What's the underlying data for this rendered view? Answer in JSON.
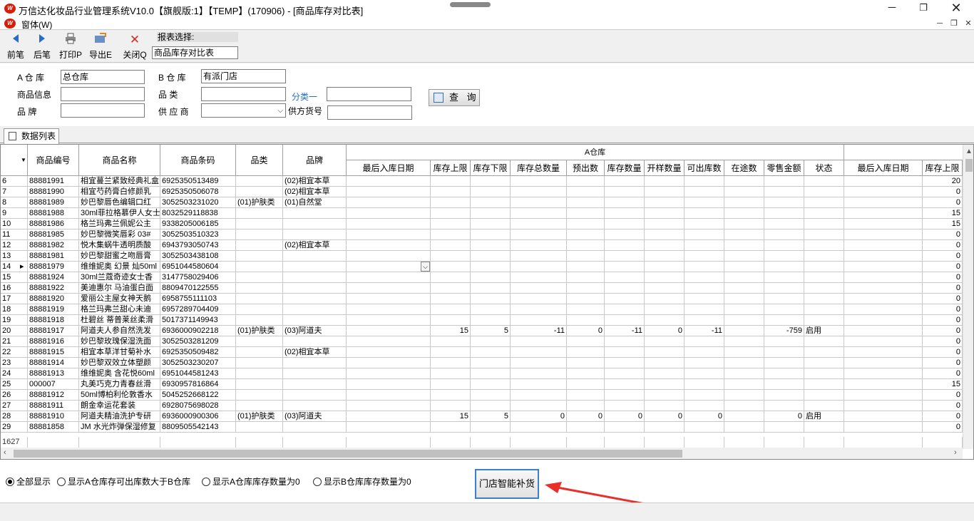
{
  "window": {
    "title": "万信达化妆品行业管理系统V10.0【旗舰版:1】【TEMP】(170906) - [商品库存对比表]",
    "menu": "窗体(W)",
    "logo_text": "W"
  },
  "toolbar": {
    "buttons": [
      {
        "label": "前笔",
        "icon": "arrow-left-icon"
      },
      {
        "label": "后笔",
        "icon": "arrow-right-icon"
      },
      {
        "label": "打印P",
        "icon": "printer-icon"
      },
      {
        "label": "导出E",
        "icon": "export-icon"
      },
      {
        "label": "关闭Q",
        "icon": "close-icon"
      }
    ],
    "report_label": "报表选择:",
    "report_value": "商品库存对比表"
  },
  "filters": {
    "a_warehouse_label": "A 仓 库",
    "a_warehouse_value": "总仓库",
    "b_warehouse_label": "B 仓 库",
    "b_warehouse_value": "有派门店",
    "product_info_label": "商品信息",
    "category_label": "品 类",
    "class1_label": "分类一",
    "brand_label": "品 牌",
    "supplier_label": "供 应 商",
    "supplier_code_label": "供方货号",
    "query_button": "查 询"
  },
  "tab": {
    "label": "数据列表"
  },
  "grid": {
    "headers": {
      "code": "商品编号",
      "name": "商品名称",
      "barcode": "商品条码",
      "category": "品类",
      "brand": "品牌",
      "a_group": "A仓库",
      "a_cols": [
        "最后入库日期",
        "库存上限",
        "库存下限",
        "库存总数量",
        "预出数",
        "库存数量",
        "开样数量",
        "可出库数",
        "在途数",
        "零售金额",
        "状态"
      ],
      "b_cols": [
        "最后入库日期",
        "库存上限"
      ]
    },
    "rows": [
      {
        "n": "6",
        "code": "88881991",
        "name": "相宜蔓兰紧致经典礼盒",
        "barcode": "6925350513489",
        "cat": "",
        "brand": "(02)相宜本草",
        "a": [
          "",
          "",
          "",
          "",
          "",
          "",
          "",
          "",
          "",
          "",
          ""
        ],
        "b": [
          "",
          "20"
        ]
      },
      {
        "n": "7",
        "code": "88881990",
        "name": "相宜芍药膏白修颜乳",
        "barcode": "6925350506078",
        "cat": "",
        "brand": "(02)相宜本草",
        "a": [
          "",
          "",
          "",
          "",
          "",
          "",
          "",
          "",
          "",
          "",
          ""
        ],
        "b": [
          "",
          "0"
        ]
      },
      {
        "n": "8",
        "code": "88881989",
        "name": "妙巴黎唇色编辑口红",
        "barcode": "3052503231020",
        "cat": "(01)护肤类",
        "brand": "(01)自然堂",
        "a": [
          "",
          "",
          "",
          "",
          "",
          "",
          "",
          "",
          "",
          "",
          ""
        ],
        "b": [
          "",
          "0"
        ]
      },
      {
        "n": "9",
        "code": "88881988",
        "name": "30ml菲拉格慕伊人女士",
        "barcode": "8032529118838",
        "cat": "",
        "brand": "",
        "a": [
          "",
          "",
          "",
          "",
          "",
          "",
          "",
          "",
          "",
          "",
          ""
        ],
        "b": [
          "",
          "15"
        ]
      },
      {
        "n": "10",
        "code": "88881986",
        "name": "格兰玛弗兰佩妮公主",
        "barcode": "9338205006185",
        "cat": "",
        "brand": "",
        "a": [
          "",
          "",
          "",
          "",
          "",
          "",
          "",
          "",
          "",
          "",
          ""
        ],
        "b": [
          "",
          "15"
        ]
      },
      {
        "n": "11",
        "code": "88881985",
        "name": "妙巴黎微笑唇彩 03#",
        "barcode": "3052503510323",
        "cat": "",
        "brand": "",
        "a": [
          "",
          "",
          "",
          "",
          "",
          "",
          "",
          "",
          "",
          "",
          ""
        ],
        "b": [
          "",
          "0"
        ]
      },
      {
        "n": "12",
        "code": "88881982",
        "name": "悦木集蜗牛透明质酸",
        "barcode": "6943793050743",
        "cat": "",
        "brand": "(02)相宜本草",
        "a": [
          "",
          "",
          "",
          "",
          "",
          "",
          "",
          "",
          "",
          "",
          ""
        ],
        "b": [
          "",
          "0"
        ]
      },
      {
        "n": "13",
        "code": "88881981",
        "name": "妙巴黎甜蜜之吻唇膏",
        "barcode": "3052503438108",
        "cat": "",
        "brand": "",
        "a": [
          "",
          "",
          "",
          "",
          "",
          "",
          "",
          "",
          "",
          "",
          ""
        ],
        "b": [
          "",
          "0"
        ]
      },
      {
        "n": "14",
        "code": "88881979",
        "name": "维维妮奥 幻景 灿50ml",
        "barcode": "6951044580604",
        "cat": "",
        "brand": "",
        "a": [
          "",
          "",
          "",
          "",
          "",
          "",
          "",
          "",
          "",
          "",
          ""
        ],
        "b": [
          "",
          "0"
        ],
        "current": true
      },
      {
        "n": "15",
        "code": "88881924",
        "name": "30ml兰蔻奇迹女士香",
        "barcode": "3147758029406",
        "cat": "",
        "brand": "",
        "a": [
          "",
          "",
          "",
          "",
          "",
          "",
          "",
          "",
          "",
          "",
          ""
        ],
        "b": [
          "",
          "0"
        ]
      },
      {
        "n": "16",
        "code": "88881922",
        "name": "美迪惠尔 马油蛋白面",
        "barcode": "8809470122555",
        "cat": "",
        "brand": "",
        "a": [
          "",
          "",
          "",
          "",
          "",
          "",
          "",
          "",
          "",
          "",
          ""
        ],
        "b": [
          "",
          "0"
        ]
      },
      {
        "n": "17",
        "code": "88881920",
        "name": "爱丽公主屋女神天鹅",
        "barcode": "6958755111103",
        "cat": "",
        "brand": "",
        "a": [
          "",
          "",
          "",
          "",
          "",
          "",
          "",
          "",
          "",
          "",
          ""
        ],
        "b": [
          "",
          "0"
        ]
      },
      {
        "n": "18",
        "code": "88881919",
        "name": "格兰玛弗兰甜心未迪",
        "barcode": "6957289704409",
        "cat": "",
        "brand": "",
        "a": [
          "",
          "",
          "",
          "",
          "",
          "",
          "",
          "",
          "",
          "",
          ""
        ],
        "b": [
          "",
          "0"
        ]
      },
      {
        "n": "19",
        "code": "88881918",
        "name": "杜碧丝 蒂普莱丝柔滑",
        "barcode": "5017371149943",
        "cat": "",
        "brand": "",
        "a": [
          "",
          "",
          "",
          "",
          "",
          "",
          "",
          "",
          "",
          "",
          ""
        ],
        "b": [
          "",
          "0"
        ]
      },
      {
        "n": "20",
        "code": "88881917",
        "name": "阿道夫人参自然洗发",
        "barcode": "6936000902218",
        "cat": "(01)护肤类",
        "brand": "(03)阿道夫",
        "a": [
          "",
          "15",
          "5",
          "-11",
          "0",
          "-11",
          "0",
          "-11",
          "",
          "-759",
          "启用"
        ],
        "b": [
          "",
          "0"
        ]
      },
      {
        "n": "21",
        "code": "88881916",
        "name": "妙巴黎玫瑰保湿洗面",
        "barcode": "3052503281209",
        "cat": "",
        "brand": "",
        "a": [
          "",
          "",
          "",
          "",
          "",
          "",
          "",
          "",
          "",
          "",
          ""
        ],
        "b": [
          "",
          "0"
        ]
      },
      {
        "n": "22",
        "code": "88881915",
        "name": "相宜本草洋甘菊补水",
        "barcode": "6925350509482",
        "cat": "",
        "brand": "(02)相宜本草",
        "a": [
          "",
          "",
          "",
          "",
          "",
          "",
          "",
          "",
          "",
          "",
          ""
        ],
        "b": [
          "",
          "0"
        ]
      },
      {
        "n": "23",
        "code": "88881914",
        "name": "妙巴黎双效立体塑颜",
        "barcode": "3052503230207",
        "cat": "",
        "brand": "",
        "a": [
          "",
          "",
          "",
          "",
          "",
          "",
          "",
          "",
          "",
          "",
          ""
        ],
        "b": [
          "",
          "0"
        ]
      },
      {
        "n": "24",
        "code": "88881913",
        "name": "维维妮奥 含花悦60ml",
        "barcode": "6951044581243",
        "cat": "",
        "brand": "",
        "a": [
          "",
          "",
          "",
          "",
          "",
          "",
          "",
          "",
          "",
          "",
          ""
        ],
        "b": [
          "",
          "0"
        ]
      },
      {
        "n": "25",
        "code": "000007",
        "name": "丸美巧克力青春丝滑",
        "barcode": "6930957816864",
        "cat": "",
        "brand": "",
        "a": [
          "",
          "",
          "",
          "",
          "",
          "",
          "",
          "",
          "",
          "",
          ""
        ],
        "b": [
          "",
          "15"
        ]
      },
      {
        "n": "26",
        "code": "88881912",
        "name": "50ml博柏利伦敦香水",
        "barcode": "5045252668122",
        "cat": "",
        "brand": "",
        "a": [
          "",
          "",
          "",
          "",
          "",
          "",
          "",
          "",
          "",
          "",
          ""
        ],
        "b": [
          "",
          "0"
        ]
      },
      {
        "n": "27",
        "code": "88881911",
        "name": "朗金幸运花套装",
        "barcode": "6928075698028",
        "cat": "",
        "brand": "",
        "a": [
          "",
          "",
          "",
          "",
          "",
          "",
          "",
          "",
          "",
          "",
          ""
        ],
        "b": [
          "",
          "0"
        ]
      },
      {
        "n": "28",
        "code": "88881910",
        "name": "阿道夫精油洗护专研",
        "barcode": "6936000900306",
        "cat": "(01)护肤类",
        "brand": "(03)阿道夫",
        "a": [
          "",
          "15",
          "5",
          "0",
          "0",
          "0",
          "0",
          "0",
          "",
          "0",
          "启用"
        ],
        "b": [
          "",
          "0"
        ]
      },
      {
        "n": "29",
        "code": "88881858",
        "name": "JM 水光炸弹保湿修复",
        "barcode": "8809505542143",
        "cat": "",
        "brand": "",
        "a": [
          "",
          "",
          "",
          "",
          "",
          "",
          "",
          "",
          "",
          "",
          ""
        ],
        "b": [
          "",
          "0"
        ]
      }
    ],
    "total_count": "1627"
  },
  "bottom": {
    "radio_all": "全部显示",
    "radio_a_gt_b": "显示A仓库存可出库数大于B仓库",
    "radio_a_zero": "显示A仓库库存数量为0",
    "radio_b_zero": "显示B仓库库存数量为0",
    "replenish_button": "门店智能补货"
  },
  "colors": {
    "accent": "#d81e06",
    "link": "#1e6fc7",
    "annotation_arrow": "#e8302a"
  }
}
